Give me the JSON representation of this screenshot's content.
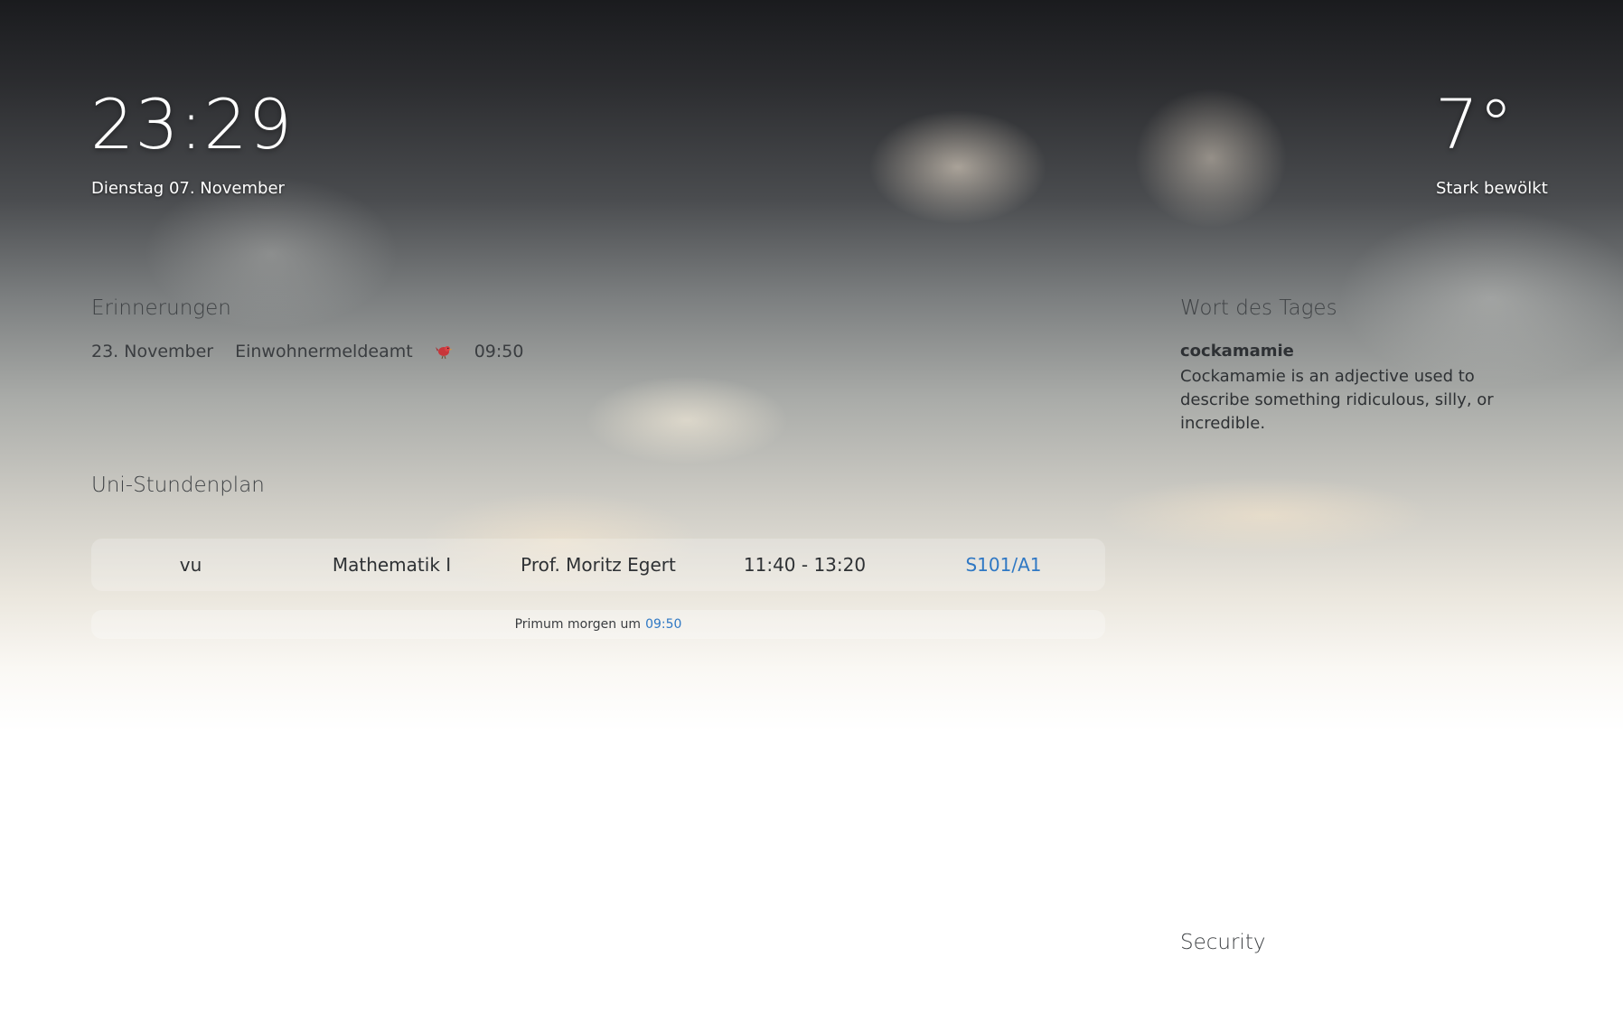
{
  "clock": {
    "time": "23:29",
    "date": "Dienstag 07. November"
  },
  "weather": {
    "temperature": "7°",
    "description": "Stark bewölkt"
  },
  "reminders": {
    "heading": "Erinnerungen",
    "items": [
      {
        "date": "23. November",
        "title": "Einwohnermeldeamt",
        "icon": "bird-icon",
        "time": "09:50"
      }
    ]
  },
  "word_of_day": {
    "heading": "Wort des Tages",
    "word": "cockamamie",
    "definition": "Cockamamie is an adjective used to describe something ridiculous, silly, or incredible."
  },
  "timetable": {
    "heading": "Uni-Stundenplan",
    "rows": [
      {
        "type": "vu",
        "course": "Mathematik I",
        "lecturer": "Prof. Moritz Egert",
        "time": "11:40 - 13:20",
        "room": "S101/A1"
      }
    ],
    "next": {
      "label": "Primum morgen um",
      "time": "09:50"
    },
    "link_color": "#2f78c4"
  },
  "security": {
    "heading": "Security"
  }
}
